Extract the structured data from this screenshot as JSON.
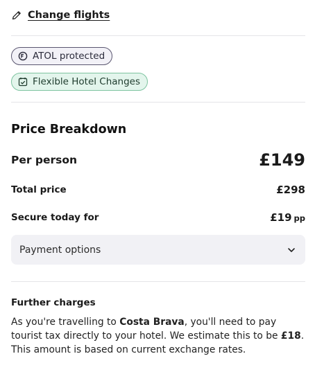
{
  "header": {
    "change_flights_label": "Change flights"
  },
  "badges": {
    "atol": "ATOL protected",
    "hotel": "Flexible Hotel Changes"
  },
  "price_breakdown": {
    "title": "Price Breakdown",
    "per_person_label": "Per person",
    "per_person_value": "£149",
    "total_label": "Total price",
    "total_value": "£298",
    "secure_label": "Secure today for",
    "secure_value": "£19",
    "secure_suffix": "pp",
    "payment_options_label": "Payment options"
  },
  "further_charges": {
    "title": "Further charges",
    "text_1": "As you're travelling to ",
    "destination": "Costa Brava",
    "text_2": ", you'll need to pay tourist tax directly to your hotel. We estimate this to be ",
    "estimate": "£18",
    "text_3": ". This amount is based on current exchange rates."
  },
  "icons": {
    "pencil": "pencil-icon",
    "atol": "atol-icon",
    "hotel": "calendar-check-icon",
    "chevron": "chevron-down-icon"
  },
  "colors": {
    "hotel_badge_bg": "#e3f5ec",
    "hotel_badge_border": "#7cc39f",
    "atol_badge_border": "#5a5670",
    "payment_bg": "#f1f1f5"
  }
}
